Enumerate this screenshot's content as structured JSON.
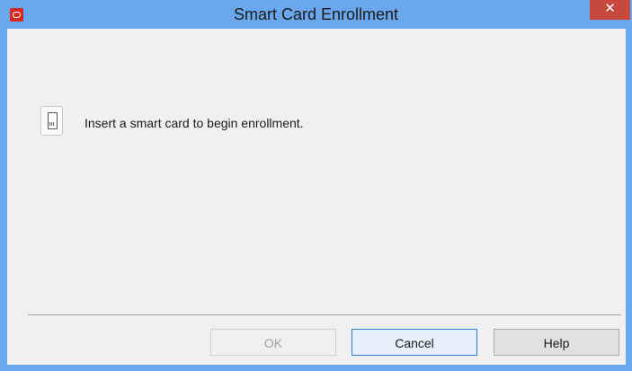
{
  "window": {
    "title": "Smart Card Enrollment",
    "close_glyph": "✕",
    "app_icon": "oracle-app-icon"
  },
  "content": {
    "icon": "smart-card-icon",
    "message": "Insert a smart card to begin enrollment."
  },
  "buttons": {
    "ok_label": "OK",
    "ok_enabled": false,
    "cancel_label": "Cancel",
    "help_label": "Help"
  },
  "colors": {
    "titlebar": "#6aa7ec",
    "close_button": "#c7483d",
    "client_background": "#f0f0f0",
    "focus_border": "#2f7fd6"
  }
}
